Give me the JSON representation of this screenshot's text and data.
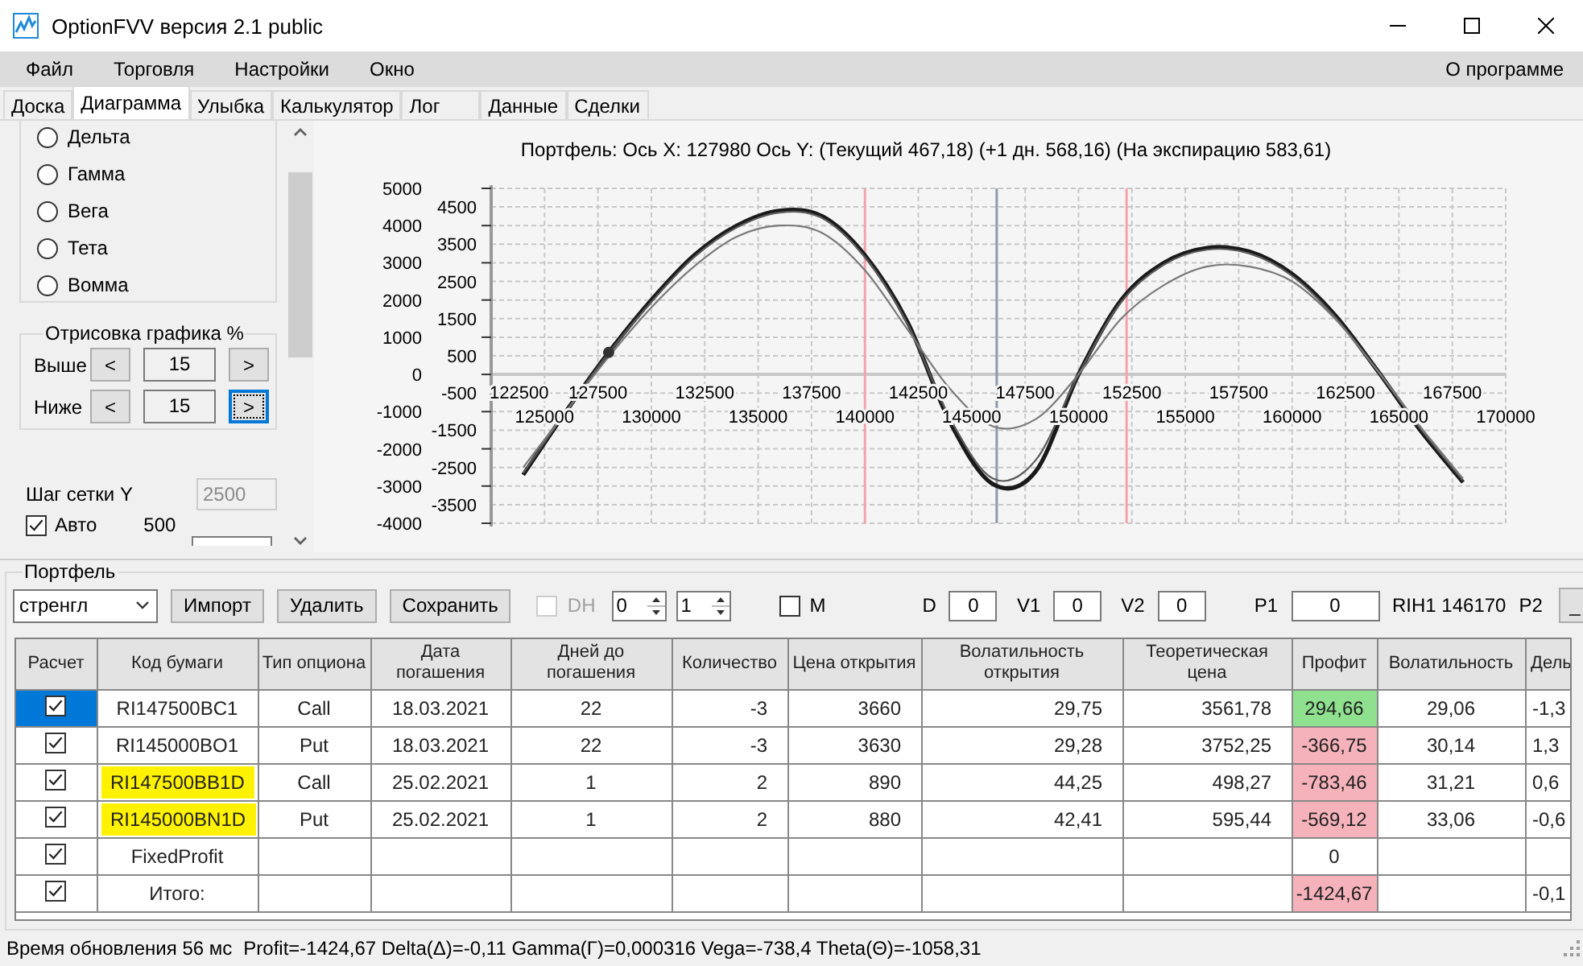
{
  "window": {
    "title": "OptionFVV версия 2.1 public"
  },
  "menu": {
    "items": [
      "Файл",
      "Торговля",
      "Настройки",
      "Окно"
    ],
    "about": "О программе"
  },
  "tabs": [
    {
      "label": "Доска",
      "selected": false
    },
    {
      "label": "Диаграмма",
      "selected": true
    },
    {
      "label": "Улыбка",
      "selected": false
    },
    {
      "label": "Калькулятор",
      "selected": false
    },
    {
      "label": "Лог",
      "selected": false
    },
    {
      "label": "Данные",
      "selected": false
    },
    {
      "label": "Сделки",
      "selected": false
    }
  ],
  "sidebar": {
    "greeks": [
      {
        "label": "Дельта",
        "selected": false
      },
      {
        "label": "Гамма",
        "selected": false
      },
      {
        "label": "Вега",
        "selected": false
      },
      {
        "label": "Тета",
        "selected": false
      },
      {
        "label": "Вомма",
        "selected": false
      }
    ],
    "range_group": {
      "title": "Отрисовка графика %",
      "rows": [
        {
          "label": "Выше",
          "value": "15",
          "dec": "<",
          "inc": ">",
          "focused": false
        },
        {
          "label": "Ниже",
          "value": "15",
          "dec": "<",
          "inc": ">",
          "focused": true
        }
      ]
    },
    "grid_step": {
      "label": "Шаг сетки Y",
      "value": "2500",
      "disabled": true,
      "auto": {
        "label": "Авто",
        "checked": true
      },
      "auto_value": "500"
    }
  },
  "chart": {
    "chart_data": {
      "type": "line",
      "title": "Портфель: Ось X: 127980 Ось Y:  (Текущий 467,18)  (+1 дн. 568,16)  (На экспирацию 583,61)",
      "x": [
        124000,
        126000,
        128000,
        130000,
        132000,
        134000,
        136000,
        138000,
        140000,
        142000,
        144000,
        146000,
        148000,
        150000,
        152000,
        154000,
        156000,
        158000,
        160000,
        162000,
        164000,
        166000,
        168000
      ],
      "series": [
        {
          "color": "#1a1a1a",
          "values": [
            -2700,
            -1000,
            590,
            2000,
            3200,
            4000,
            4400,
            4250,
            3200,
            1400,
            -1300,
            -2950,
            -2600,
            0,
            2000,
            3000,
            3400,
            3300,
            2700,
            1600,
            100,
            -1500,
            -2900
          ]
        },
        {
          "color": "#5a5a5a",
          "values": [
            -2650,
            -1000,
            570,
            1950,
            3150,
            3950,
            4350,
            4200,
            3150,
            1350,
            -1200,
            -2800,
            -2300,
            0,
            1950,
            2950,
            3350,
            3250,
            2650,
            1550,
            100,
            -1450,
            -2850
          ]
        },
        {
          "color": "#7a7a7a",
          "values": [
            -2500,
            -1000,
            470,
            1800,
            2900,
            3700,
            4000,
            3800,
            2800,
            1200,
            -400,
            -1400,
            -1200,
            0,
            1500,
            2400,
            2900,
            2900,
            2500,
            1500,
            100,
            -1400,
            -2800
          ]
        }
      ],
      "xlim": [
        122500,
        170000
      ],
      "ylim": [
        -4000,
        5000
      ],
      "grid": true,
      "xticks": [
        122500,
        127500,
        132500,
        137500,
        142500,
        147500,
        152500,
        157500,
        162500,
        167500
      ],
      "yticks": [
        -4000,
        -3000,
        -2000,
        -1000,
        0,
        1000,
        2000,
        3000,
        4000,
        5000
      ],
      "ref_lines": [
        {
          "axis": "x",
          "value": 140000,
          "color": "#f4a3ad"
        },
        {
          "axis": "x",
          "value": 146170,
          "color": "#8d9aaa"
        },
        {
          "axis": "x",
          "value": 152250,
          "color": "#f4a3ad"
        }
      ],
      "annotations": [
        "125000",
        "130000",
        "135000",
        "140000",
        "145000",
        "150000",
        "155000",
        "160000",
        "165000",
        "170000",
        "-3500",
        "-2500",
        "-1500",
        "-500",
        "500",
        "1500",
        "2500",
        "3500",
        "4500"
      ]
    }
  },
  "portfolio": {
    "title": "Портфель",
    "strategy": "стренгл",
    "buttons": [
      "Импорт",
      "Удалить",
      "Сохранить"
    ],
    "dh": {
      "label": "DH",
      "checked": false,
      "disabled": true
    },
    "spinners": [
      "0",
      "1"
    ],
    "m": {
      "label": "M",
      "checked": false
    },
    "fields": [
      {
        "label": "D",
        "value": "0"
      },
      {
        "label": "V1",
        "value": "0"
      },
      {
        "label": "V2",
        "value": "0"
      },
      {
        "label": "P1",
        "value": "0"
      }
    ],
    "instrument": "RIH1 146170",
    "p2_label": "P2",
    "p2_button": "_"
  },
  "table": {
    "columns": [
      "Расчет",
      "Код бумаги",
      "Тип опциона",
      "Дата погашения",
      "Дней до погашения",
      "Количество",
      "Цена открытия",
      "Волатильность открытия",
      "Теоретическая цена",
      "Профит",
      "Волатильность",
      "Дель"
    ],
    "rows": [
      {
        "calc": true,
        "selected": true,
        "highlighted": false,
        "color": "#8fe08f",
        "code": "RI147500BC1",
        "type": "Call",
        "date": "18.03.2021",
        "days": "22",
        "qty": "-3",
        "open_price": "3660",
        "open_vol": "29,75",
        "theo_price": "3561,78",
        "profit": "294,66",
        "vol": "29,06",
        "delta": "-1,3"
      },
      {
        "calc": true,
        "selected": false,
        "highlighted": false,
        "color": "#f6b2bb",
        "code": "RI145000BO1",
        "type": "Put",
        "date": "18.03.2021",
        "days": "22",
        "qty": "-3",
        "open_price": "3630",
        "open_vol": "29,28",
        "theo_price": "3752,25",
        "profit": "-366,75",
        "vol": "30,14",
        "delta": "1,3"
      },
      {
        "calc": true,
        "selected": false,
        "highlighted": true,
        "color": "#f6b2bb",
        "code": "RI147500BB1D",
        "type": "Call",
        "date": "25.02.2021",
        "days": "1",
        "qty": "2",
        "open_price": "890",
        "open_vol": "44,25",
        "theo_price": "498,27",
        "profit": "-783,46",
        "vol": "31,21",
        "delta": "0,6"
      },
      {
        "calc": true,
        "selected": false,
        "highlighted": true,
        "color": "#f6b2bb",
        "code": "RI145000BN1D",
        "type": "Put",
        "date": "25.02.2021",
        "days": "1",
        "qty": "2",
        "open_price": "880",
        "open_vol": "42,41",
        "theo_price": "595,44",
        "profit": "-569,12",
        "vol": "33,06",
        "delta": "-0,6"
      },
      {
        "calc": true,
        "selected": false,
        "highlighted": false,
        "code": "FixedProfit",
        "profit": "0"
      },
      {
        "calc": true,
        "selected": false,
        "highlighted": false,
        "color": "#f6b2bb",
        "code": "Итого:",
        "profit": "-1424,67",
        "delta": "-0,1"
      }
    ]
  },
  "status_bar": {
    "update_time": "Время обновления 56 мс",
    "metrics": "Profit=-1424,67 Delta(Δ)=-0,11 Gamma(Γ)=0,000316 Vega=-738,4 Theta(Θ)=-1058,31"
  }
}
